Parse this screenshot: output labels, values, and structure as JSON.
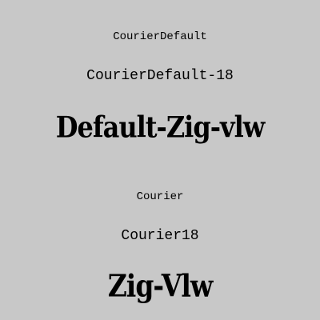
{
  "background_color": "#c8c8c8",
  "text_color": "#000000",
  "samples": [
    {
      "text": "CourierDefault"
    },
    {
      "text": "CourierDefault-18"
    },
    {
      "text": "Default-Zig-vlw"
    },
    {
      "text": "Courier"
    },
    {
      "text": "Courier18"
    },
    {
      "text": "Zig-Vlw"
    }
  ]
}
